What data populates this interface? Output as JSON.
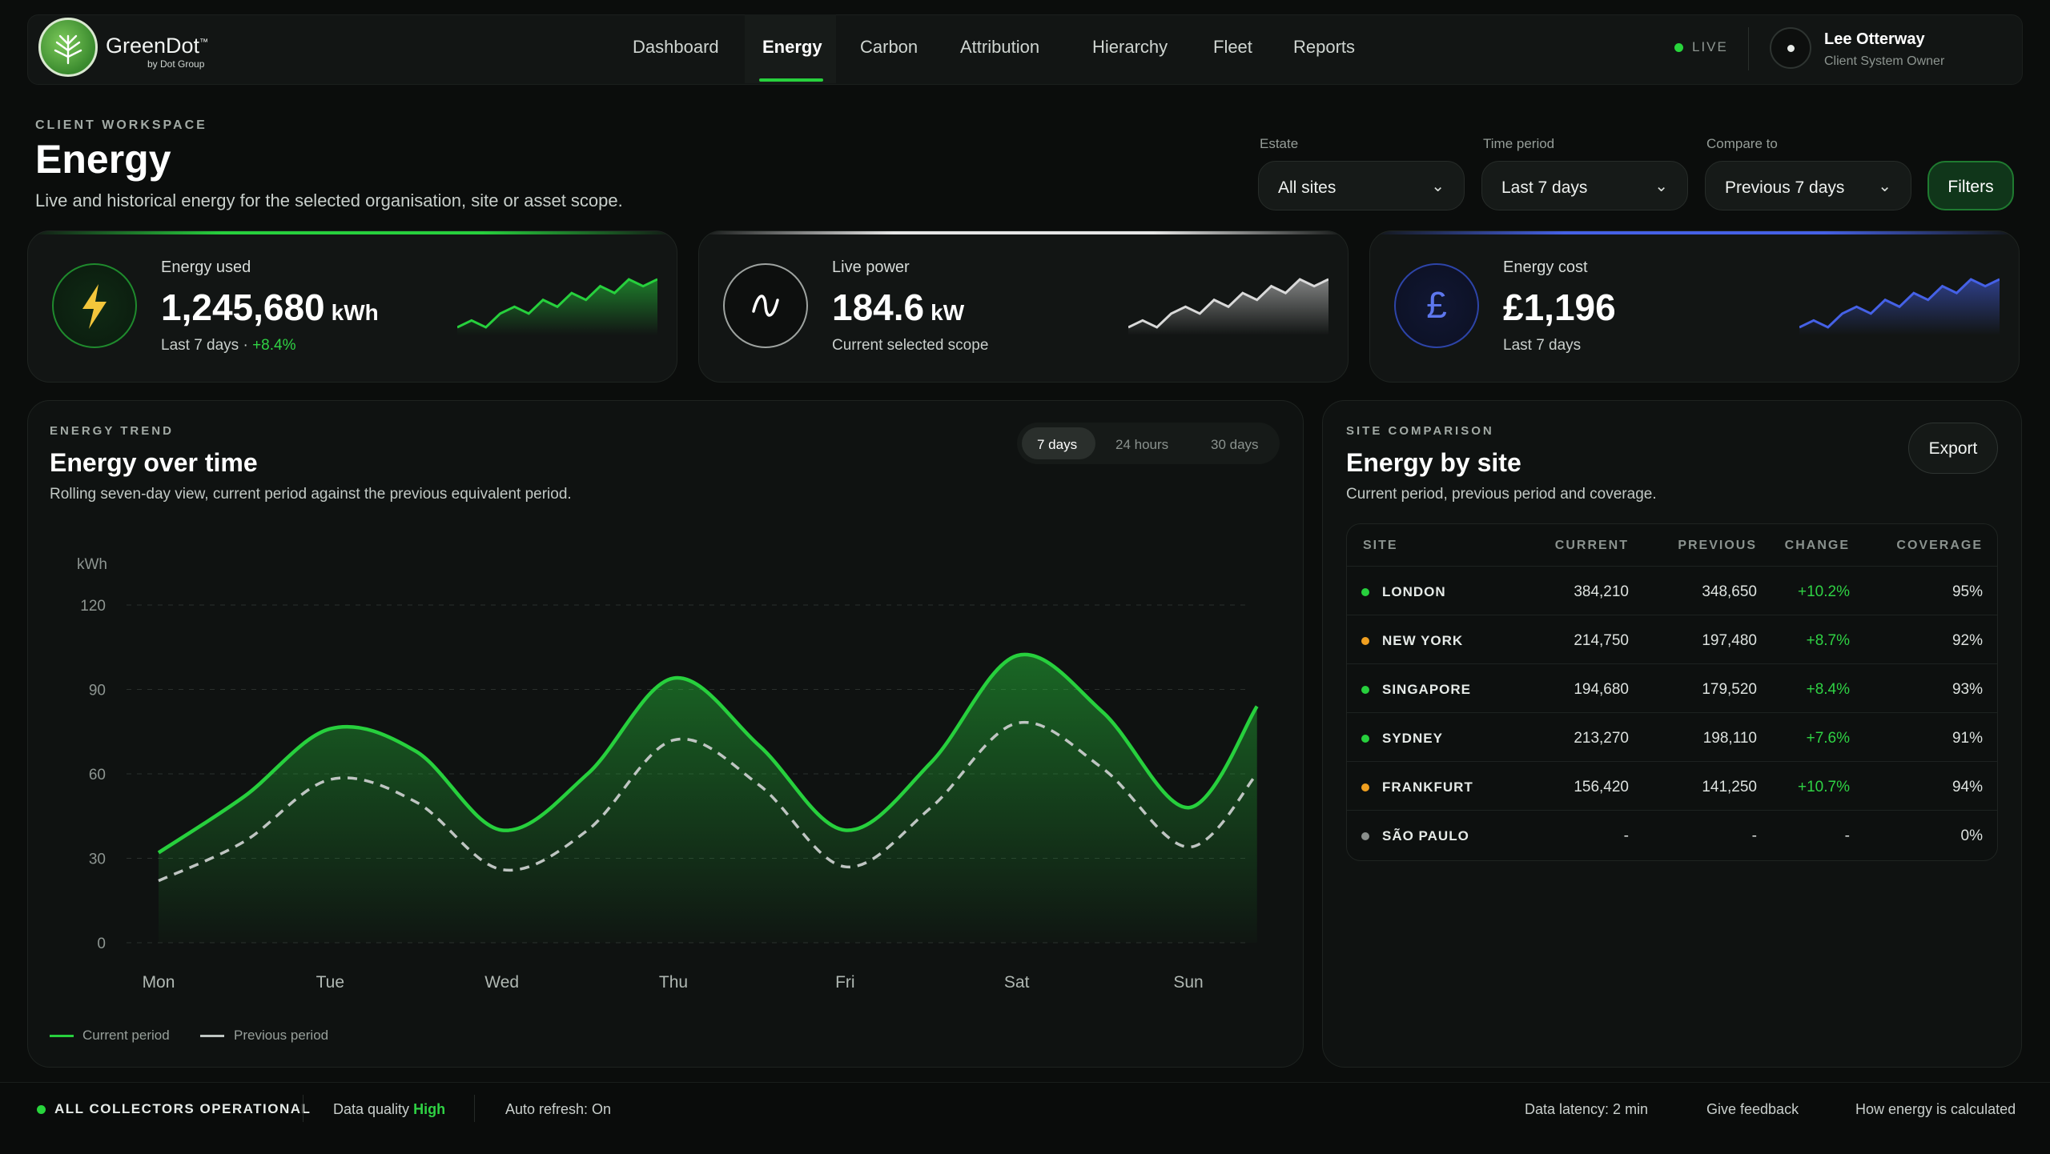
{
  "brand": {
    "name": "GreenDot",
    "tm": "™",
    "sub": "by Dot Group"
  },
  "nav": {
    "items": [
      "Dashboard",
      "Energy",
      "Carbon",
      "Attribution",
      "Hierarchy",
      "Fleet",
      "Reports"
    ],
    "active": "Energy"
  },
  "status": {
    "live": "LIVE"
  },
  "user": {
    "name": "Lee Otterway",
    "role": "Client System Owner"
  },
  "header": {
    "eyebrow": "CLIENT WORKSPACE",
    "title": "Energy",
    "subtitle": "Live and historical energy for the selected organisation, site or asset scope."
  },
  "filters": {
    "estate": {
      "label": "Estate",
      "value": "All sites"
    },
    "period": {
      "label": "Time period",
      "value": "Last 7 days"
    },
    "compare": {
      "label": "Compare to",
      "value": "Previous 7 days"
    },
    "button": "Filters"
  },
  "kpis": [
    {
      "label": "Energy used",
      "value": "1,245,680",
      "unit": "kWh",
      "sub": "Last 7 days · ",
      "delta": "+8.4%",
      "color": "#27d03d",
      "icon": "lightning-icon",
      "trend": [
        3,
        4,
        3,
        5,
        6,
        5,
        7,
        6,
        8,
        7,
        9,
        8,
        10,
        9,
        10
      ]
    },
    {
      "label": "Live power",
      "value": "184.6",
      "unit": "kW",
      "sub": "Current selected scope",
      "delta": "",
      "color": "#d9d9d9",
      "icon": "wave-icon",
      "trend": [
        3,
        4,
        3,
        5,
        6,
        5,
        7,
        6,
        8,
        7,
        9,
        8,
        10,
        9,
        10
      ]
    },
    {
      "label": "Energy cost",
      "value": "£1,196",
      "unit": "",
      "sub": "Last 7 days",
      "delta": "",
      "color": "#4561e6",
      "icon": "pound-icon",
      "trend": [
        3,
        4,
        3,
        5,
        6,
        5,
        7,
        6,
        8,
        7,
        9,
        8,
        10,
        9,
        10
      ]
    }
  ],
  "trend_panel": {
    "eyebrow": "ENERGY TREND",
    "title": "Energy over time",
    "subtitle": "Rolling seven-day view, current period against the previous equivalent period.",
    "ranges": [
      "7 days",
      "24 hours",
      "30 days"
    ],
    "active_range": "7 days",
    "legend": [
      "Current period",
      "Previous period"
    ]
  },
  "chart_data": {
    "type": "area",
    "ylabel": "kWh",
    "ylim": [
      0,
      120
    ],
    "yticks": [
      0,
      30,
      60,
      90,
      120
    ],
    "categories": [
      "Mon",
      "Tue",
      "Wed",
      "Thu",
      "Fri",
      "Sat",
      "Sun"
    ],
    "grid": true,
    "series": [
      {
        "name": "Current period",
        "x": [
          0,
          0.5,
          1,
          1.5,
          2,
          2.5,
          3,
          3.5,
          4,
          4.5,
          5,
          5.5,
          6,
          6.4
        ],
        "values": [
          32,
          52,
          76,
          68,
          40,
          60,
          94,
          70,
          40,
          64,
          102,
          82,
          48,
          84
        ],
        "color": "#27d03d"
      },
      {
        "name": "Previous period",
        "x": [
          0,
          0.5,
          1,
          1.5,
          2,
          2.5,
          3,
          3.5,
          4,
          4.5,
          5,
          5.5,
          6,
          6.4
        ],
        "values": [
          22,
          36,
          58,
          50,
          26,
          40,
          72,
          56,
          27,
          48,
          78,
          62,
          34,
          60
        ],
        "color": "#bfc5c2"
      }
    ]
  },
  "site_panel": {
    "eyebrow": "SITE COMPARISON",
    "title": "Energy by site",
    "subtitle": "Current period, previous period and coverage.",
    "export": "Export",
    "columns": [
      "SITE",
      "CURRENT",
      "PREVIOUS",
      "CHANGE",
      "COVERAGE"
    ],
    "rows": [
      {
        "site": "LONDON",
        "current": "384,210",
        "previous": "348,650",
        "change": "+10.2%",
        "coverage": "95%",
        "status": "#27d03d"
      },
      {
        "site": "NEW YORK",
        "current": "214,750",
        "previous": "197,480",
        "change": "+8.7%",
        "coverage": "92%",
        "status": "#f0a020"
      },
      {
        "site": "SINGAPORE",
        "current": "194,680",
        "previous": "179,520",
        "change": "+8.4%",
        "coverage": "93%",
        "status": "#27d03d"
      },
      {
        "site": "SYDNEY",
        "current": "213,270",
        "previous": "198,110",
        "change": "+7.6%",
        "coverage": "91%",
        "status": "#27d03d"
      },
      {
        "site": "FRANKFURT",
        "current": "156,420",
        "previous": "141,250",
        "change": "+10.7%",
        "coverage": "94%",
        "status": "#f0a020"
      },
      {
        "site": "SÃO PAULO",
        "current": "-",
        "previous": "-",
        "change": "-",
        "coverage": "0%",
        "status": "#8a8f8c"
      }
    ]
  },
  "footer": {
    "collectors": "ALL COLLECTORS OPERATIONAL",
    "quality_label": "Data quality",
    "quality_value": "High",
    "refresh": "Auto refresh: On",
    "latency": "Data latency: 2 min",
    "feedback": "Give feedback",
    "how": "How energy is calculated"
  }
}
